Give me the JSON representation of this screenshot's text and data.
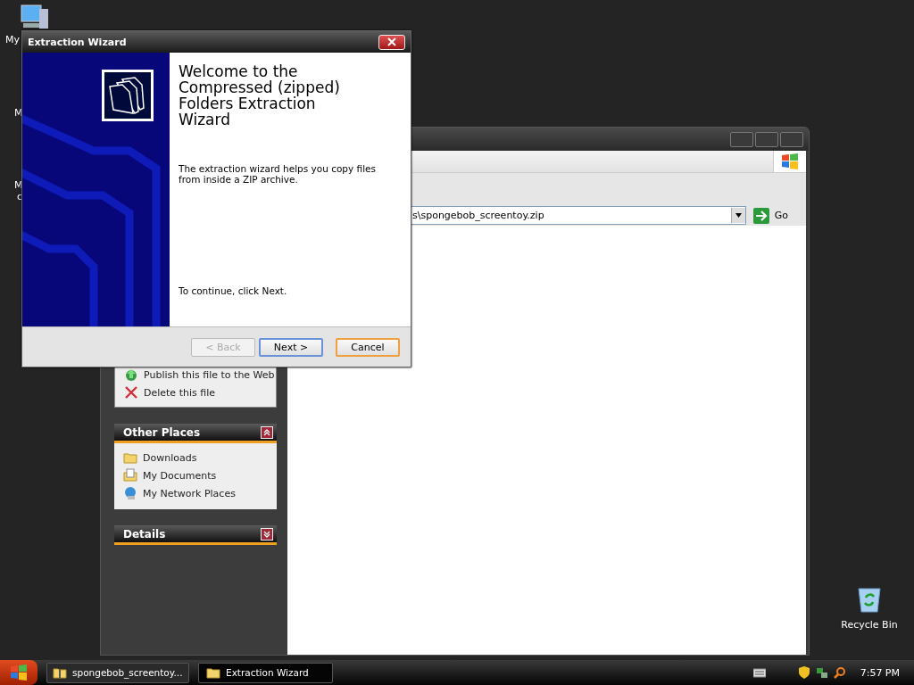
{
  "desktop": {
    "partial_labels": [
      "My",
      "M",
      "M",
      "c"
    ],
    "recycle_bin": "Recycle Bin"
  },
  "explorer": {
    "address": "s\\spongebob_screentoy.zip",
    "go": "Go",
    "tasks": [
      {
        "label": "Publish this file to the Web",
        "kind": "publish"
      },
      {
        "label": "Delete this file",
        "kind": "delete"
      }
    ],
    "other_places": {
      "title": "Other Places",
      "expanded": true,
      "items": [
        {
          "label": "Downloads",
          "kind": "folder"
        },
        {
          "label": "My Documents",
          "kind": "documents"
        },
        {
          "label": "My Network Places",
          "kind": "network"
        }
      ]
    },
    "details": {
      "title": "Details",
      "expanded": false
    }
  },
  "dialog": {
    "title": "Extraction Wizard",
    "heading": "Welcome to the Compressed (zipped) Folders Extraction Wizard",
    "intro": "The extraction wizard helps you copy files from inside a ZIP archive.",
    "hint": "To continue, click Next.",
    "buttons": [
      {
        "label": "< Back",
        "disabled": true,
        "default": false,
        "focused": false
      },
      {
        "label": "Next >",
        "disabled": false,
        "default": true,
        "focused": false
      },
      {
        "label": "Cancel",
        "disabled": false,
        "default": false,
        "focused": true
      }
    ]
  },
  "taskbar": {
    "tasks": [
      {
        "label": "spongebob_screentoy...",
        "kind": "zip",
        "selected": false
      },
      {
        "label": "Extraction Wizard",
        "kind": "folder",
        "selected": true
      }
    ],
    "clock": "7:57 PM"
  }
}
